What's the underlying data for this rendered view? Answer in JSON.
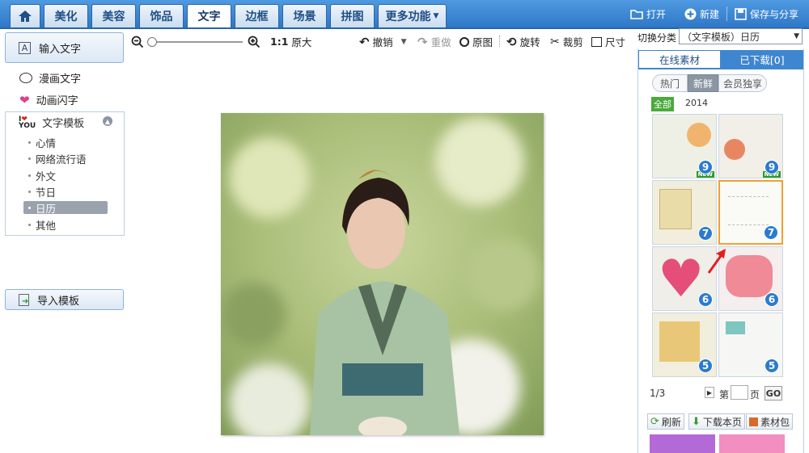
{
  "nav": {
    "tabs": [
      "美化",
      "美容",
      "饰品",
      "文字",
      "边框",
      "场景",
      "拼图",
      "更多功能"
    ],
    "active_index": 3
  },
  "top_actions": {
    "open": "打开",
    "new": "新建",
    "save_share": "保存与分享"
  },
  "left": {
    "input_text": "输入文字",
    "comic_text": "漫画文字",
    "animated_text": "动画闪字",
    "template_title": "文字模板",
    "template_items": [
      "心情",
      "网络流行语",
      "外文",
      "节日",
      "日历",
      "其他"
    ],
    "selected_item": "日历",
    "import_template": "导入模板"
  },
  "toolbar": {
    "ratio": "1:1",
    "original_size": "原大",
    "undo": "撤销",
    "redo": "重做",
    "original": "原图",
    "rotate": "旋转",
    "crop": "裁剪",
    "size": "尺寸"
  },
  "right": {
    "switch_label": "切换分类",
    "category_value": "（文字模板）日历",
    "tab_online": "在线素材",
    "tab_downloaded": "已下载[0]",
    "filters": [
      "热门",
      "新鲜",
      "会员独享"
    ],
    "active_filter": "新鲜",
    "year_all": "全部",
    "year": "2014",
    "thumbs": [
      {
        "count": "9",
        "new": "NEW"
      },
      {
        "count": "9",
        "new": "NEW"
      },
      {
        "count": "7",
        "new": ""
      },
      {
        "count": "7",
        "new": ""
      },
      {
        "count": "6",
        "new": ""
      },
      {
        "count": "6",
        "new": ""
      },
      {
        "count": "5",
        "new": ""
      },
      {
        "count": "5",
        "new": ""
      }
    ],
    "pagination": "1/3",
    "page_prefix": "第",
    "page_suffix": "页",
    "go": "GO",
    "refresh": "刷新",
    "download_page": "下载本页",
    "material_pack": "素材包"
  },
  "colors": {
    "primary": "#2f78c8",
    "green": "#4aaa3a",
    "highlight": "#f0a030"
  }
}
